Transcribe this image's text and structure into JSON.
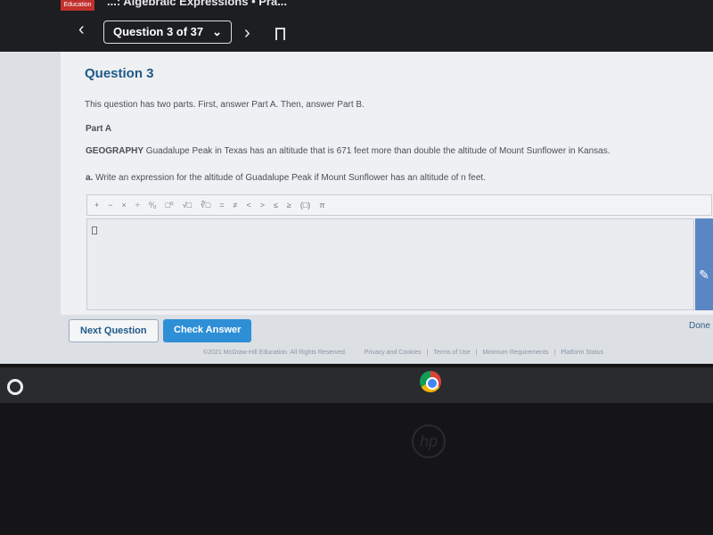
{
  "header": {
    "logo_text": "Education",
    "title": "...: Algebraic Expressions • Pra...",
    "question_selector": "Question 3 of 37"
  },
  "question": {
    "heading": "Question 3",
    "intro": "This question has two parts. First, answer Part A. Then, answer Part B.",
    "part_label": "Part A",
    "subject": "GEOGRAPHY",
    "prompt": "Guadalupe Peak in Texas has an altitude that is 671 feet more than double the altitude of Mount Sunflower in Kansas.",
    "task_prefix": "a.",
    "task": "Write an expression for the altitude of Guadalupe Peak if Mount Sunflower has an altitude of n feet."
  },
  "toolbar": [
    "+",
    "−",
    "×",
    "÷",
    "⁰⁄₀",
    "□⁰",
    "√□",
    "∛□",
    "=",
    "≠",
    "<",
    ">",
    "≤",
    "≥",
    "(□)",
    "π"
  ],
  "buttons": {
    "next": "Next Question",
    "check": "Check Answer",
    "done": "Done"
  },
  "footer": {
    "copyright": "©2021 McGraw-Hill Education. All Rights Reserved.",
    "links": [
      "Privacy and Cookies",
      "|",
      "Terms of Use",
      "|",
      "Minimum Requirements",
      "|",
      "Platform Status"
    ]
  },
  "colors": {
    "accent": "#2e8fd6",
    "heading": "#1f5a88"
  }
}
